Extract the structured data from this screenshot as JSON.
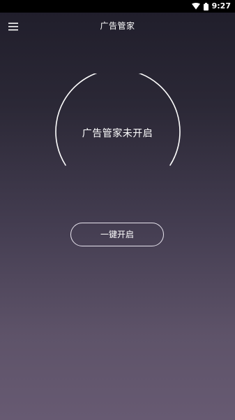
{
  "status_bar": {
    "time": "9:27",
    "icons": [
      "wifi-icon",
      "battery-icon"
    ]
  },
  "header": {
    "menu_icon": "hamburger-menu-icon",
    "title": "广告管家"
  },
  "main": {
    "gauge_status_text": "广告管家未开启",
    "enable_button_label": "一键开启"
  }
}
